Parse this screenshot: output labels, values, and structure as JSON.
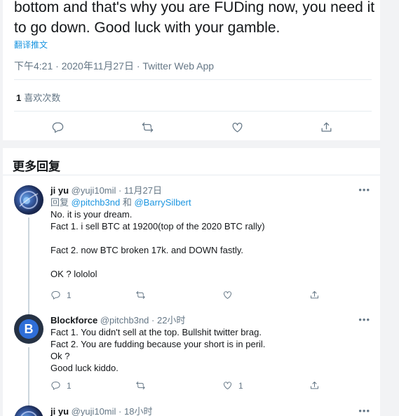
{
  "tweet": {
    "text_line1": "bottom and that's why you are FUDing now, you need it",
    "text_line2": "to go down. Good luck with your gamble.",
    "translate": "翻译推文",
    "meta": "下午4:21 · 2020年11月27日 · Twitter Web App",
    "likes_count": "1",
    "likes_label": "喜欢次数"
  },
  "replies_heading": "更多回复",
  "replies": [
    {
      "name": "ji yu",
      "handle": "@yuji10mil",
      "time": "· 11月27日",
      "reply_prefix": "回复",
      "mention1": "@pitchb3nd",
      "and": "和",
      "mention2": "@BarrySilbert",
      "lines": [
        "No.  it is your dream.",
        "Fact 1.  i sell BTC at 19200(top of the 2020 BTC rally)",
        "",
        "Fact 2. now BTC broken 17k. and DOWN fastly.",
        "",
        "OK ? lololol"
      ],
      "reply_count": "1",
      "like_count": ""
    },
    {
      "name": "Blockforce",
      "handle": "@pitchb3nd",
      "time": "· 22小时",
      "lines": [
        "Fact 1. You didn't sell at the top. Bullshit twitter brag.",
        "Fact 2. You are fudding because your short is in peril.",
        "Ok ?",
        "Good luck kiddo."
      ],
      "reply_count": "1",
      "like_count": "1"
    },
    {
      "name": "ji yu",
      "handle": "@yuji10mil",
      "time": "· 18小时"
    }
  ],
  "more_glyph": "•••",
  "colors": {
    "link": "#1b95e0",
    "muted": "#657786",
    "text": "#14171a"
  }
}
